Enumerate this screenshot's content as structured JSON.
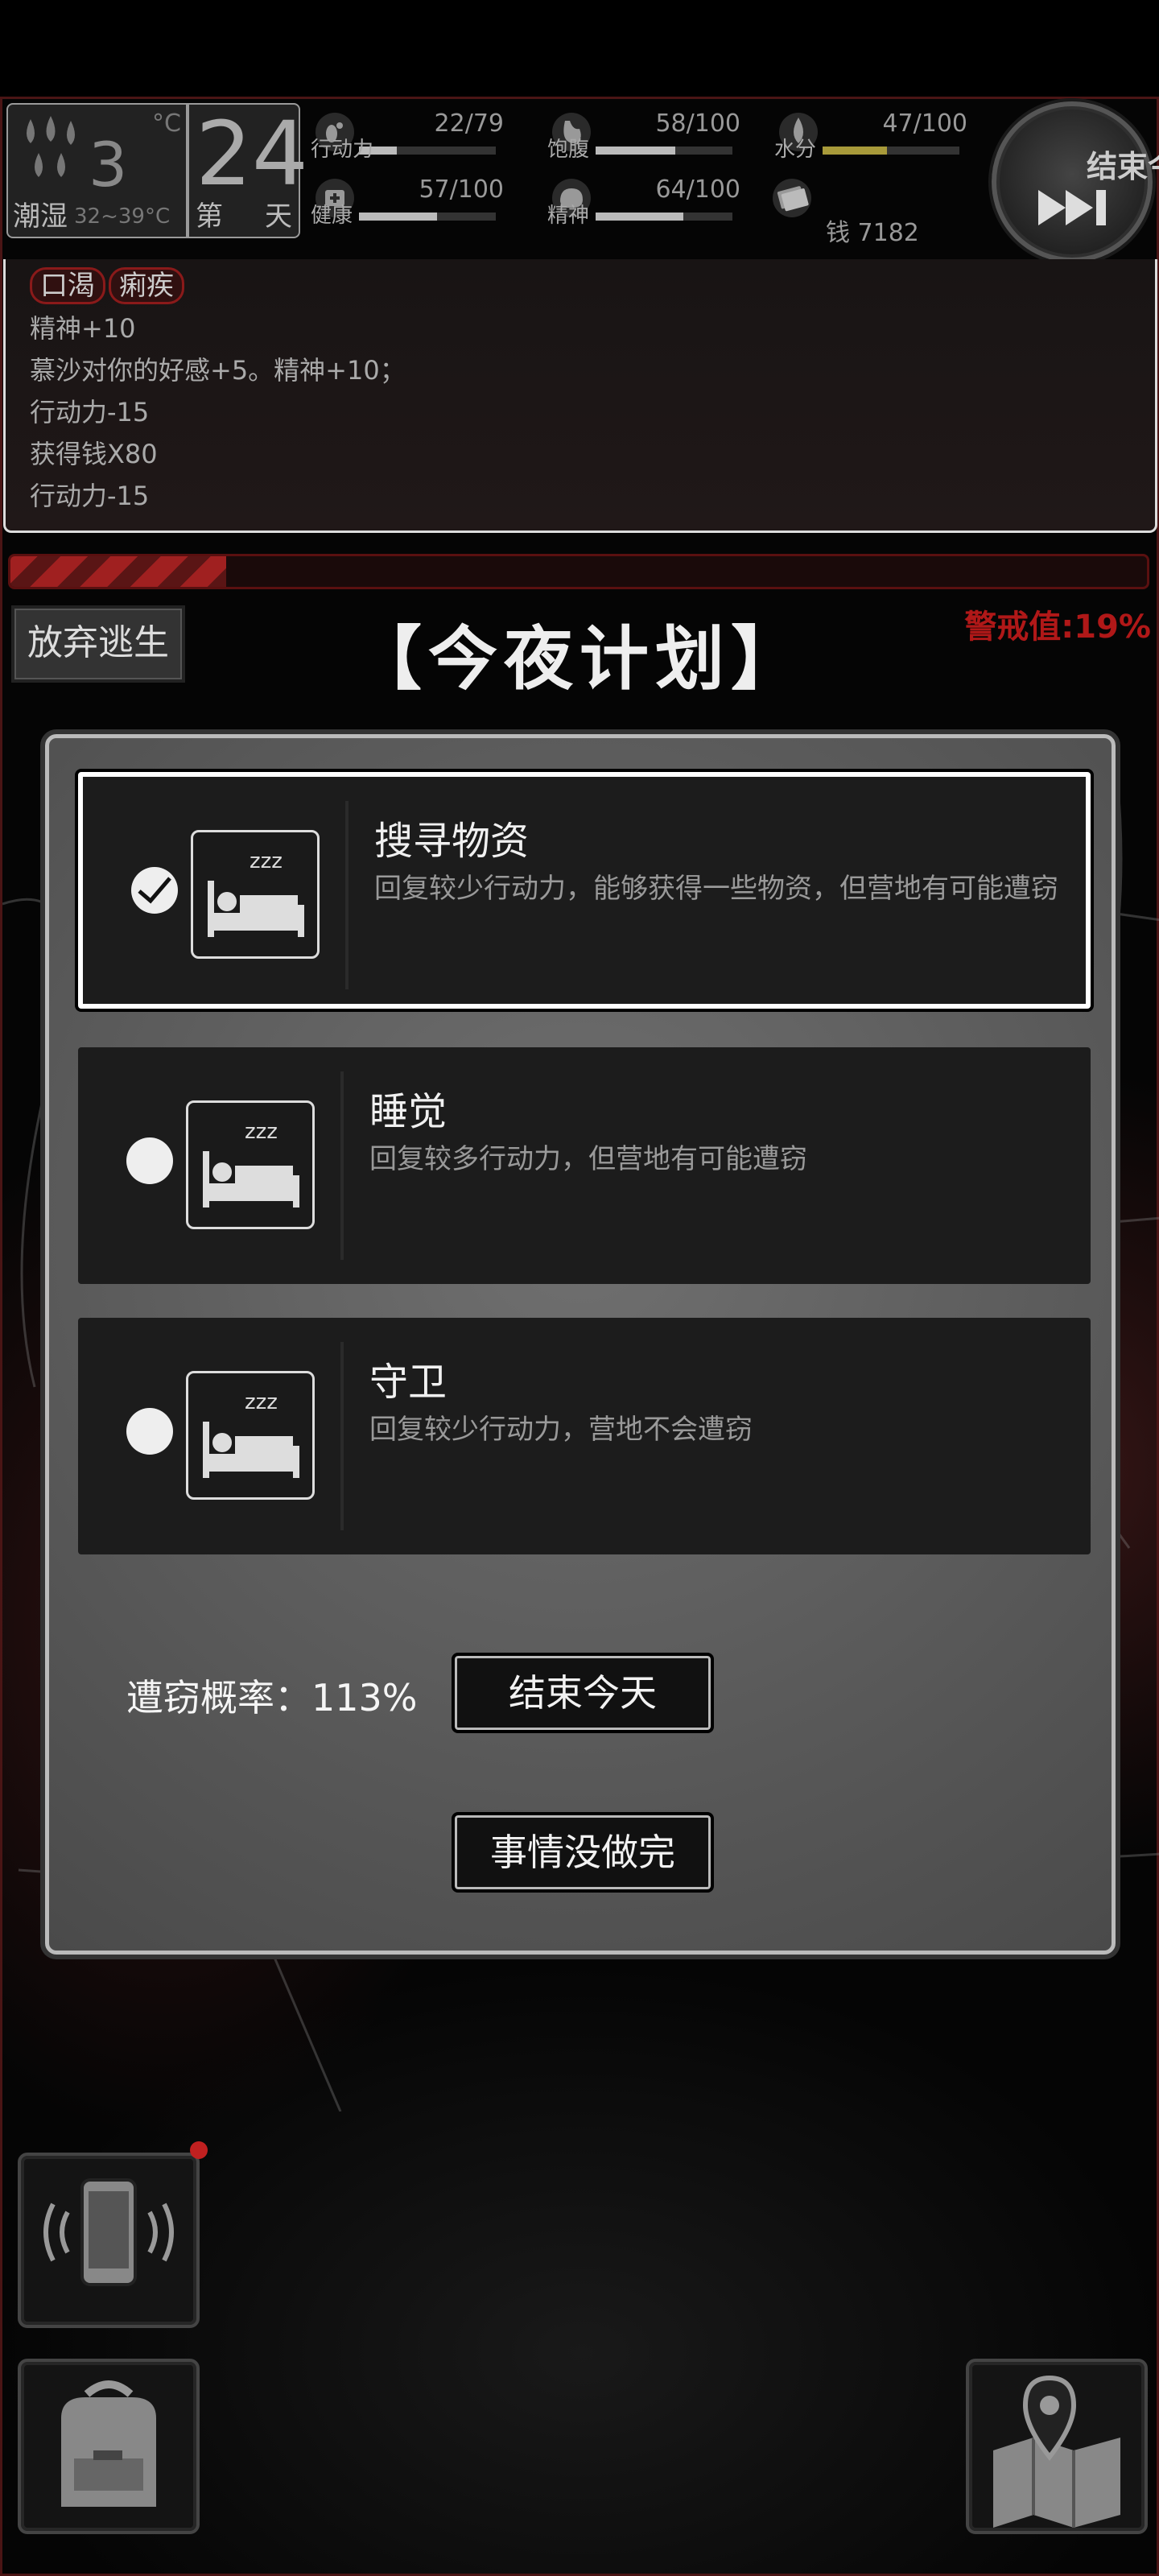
{
  "weather": {
    "value": "3",
    "unit": "°C",
    "humidity": "潮湿",
    "temp_range": "32~39°C"
  },
  "day": {
    "number": "24",
    "label_left": "第",
    "label_right": "天"
  },
  "stats": [
    {
      "label": "行动力",
      "value": "22/79",
      "fraction": 0.278
    },
    {
      "label": "饱腹",
      "value": "58/100",
      "fraction": 0.58
    },
    {
      "label": "水分",
      "value": "47/100",
      "fraction": 0.47
    },
    {
      "label": "健康",
      "value": "57/100",
      "fraction": 0.57
    },
    {
      "label": "精神",
      "value": "64/100",
      "fraction": 0.64
    }
  ],
  "money": {
    "label": "钱",
    "value": "7182"
  },
  "end_day_button": {
    "label": "结束今日"
  },
  "log": {
    "tags": [
      "口渴",
      "痢疾"
    ],
    "lines": [
      "精神+10",
      "慕沙对你的好感+5。精神+10；",
      "行动力-15",
      "获得钱X80",
      "行动力-15"
    ]
  },
  "alert": {
    "label": "警戒值:19%",
    "fraction": 0.19
  },
  "give_up_button": {
    "label": "放弃逃生"
  },
  "plan_title": "【今夜计划】",
  "options": [
    {
      "title": "搜寻物资",
      "desc": "回复较少行动力，能够获得一些物资，但营地有可能遭窃",
      "selected": true
    },
    {
      "title": "睡觉",
      "desc": "回复较多行动力，但营地有可能遭窃",
      "selected": false
    },
    {
      "title": "守卫",
      "desc": "回复较少行动力，营地不会遭窃",
      "selected": false
    }
  ],
  "theft_rate": "遭窃概率：113%",
  "end_today_button": "结束今天",
  "not_done_button": "事情没做完",
  "colors": {
    "accent_red": "#b01818",
    "panel": "#5a5a5a",
    "option_bg": "#1c1c1c"
  }
}
